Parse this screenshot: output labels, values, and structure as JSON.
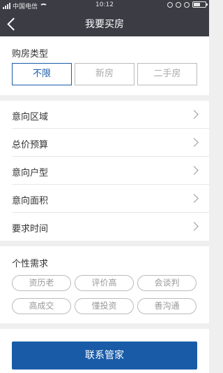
{
  "status_bar": {
    "carrier": "中国电信",
    "time": "10:12"
  },
  "nav": {
    "title": "我要买房"
  },
  "purchase_type": {
    "label": "购房类型",
    "options": [
      "不限",
      "新房",
      "二手房"
    ],
    "selected": "不限"
  },
  "preferences": {
    "rows": [
      "意向区域",
      "总价预算",
      "意向户型",
      "意向面积",
      "要求时间"
    ]
  },
  "personal_needs": {
    "label": "个性需求",
    "tags": [
      "资历老",
      "评价高",
      "会谈判",
      "高成交",
      "懂投资",
      "善沟通"
    ]
  },
  "contact_button": {
    "label": "联系管家"
  },
  "colors": {
    "bar_bg": "#3b3c44",
    "accent": "#1a5ba8"
  }
}
